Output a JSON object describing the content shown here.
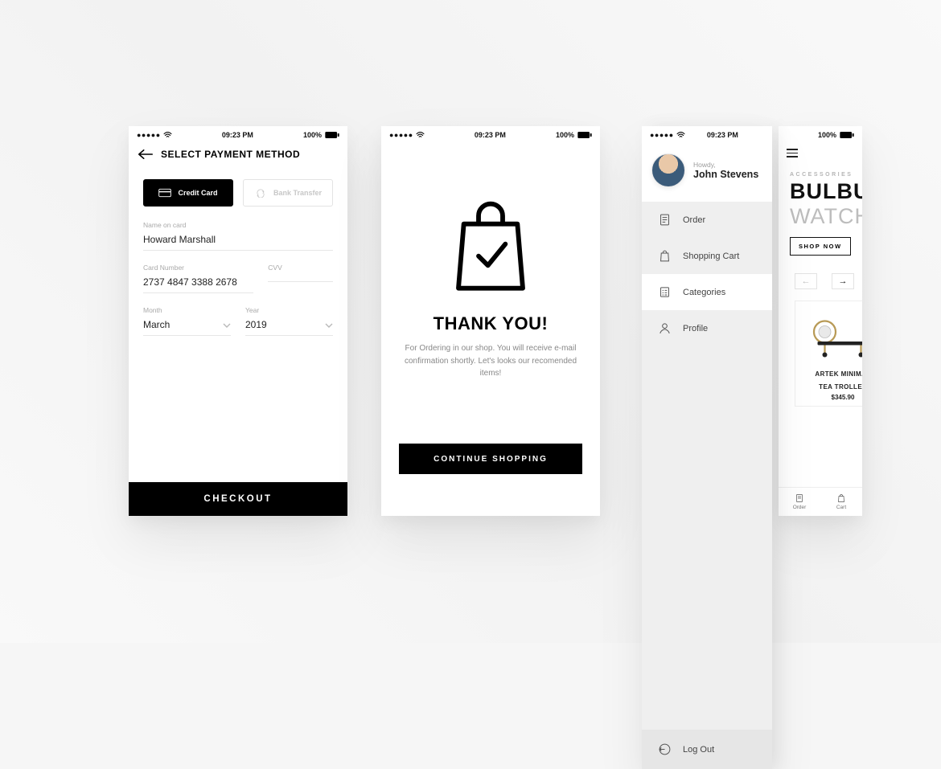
{
  "status": {
    "time": "09:23 PM",
    "battery": "100%"
  },
  "screen1": {
    "title": "SELECT PAYMENT METHOD",
    "tabs": {
      "credit": "Credit Card",
      "bank": "Bank Transfer"
    },
    "labels": {
      "name": "Name on card",
      "cardnum": "Card Number",
      "cvv": "CVV",
      "month": "Month",
      "year": "Year"
    },
    "values": {
      "name": "Howard Marshall",
      "cardnum": "2737 4847 3388 2678",
      "cvv": "",
      "month": "March",
      "year": "2019"
    },
    "checkout": "CHECKOUT"
  },
  "screen2": {
    "heading": "THANK YOU!",
    "body": "For Ordering in our shop. You will receive e-mail confirmation shortly. Let's looks our recomended items!",
    "cta": "CONTINUE SHOPPING"
  },
  "screen3": {
    "greeting": "Howdy,",
    "username": "John Stevens",
    "nav": {
      "order": "Order",
      "cart": "Shopping Cart",
      "categories": "Categories",
      "profile": "Profile"
    },
    "logout": "Log Out"
  },
  "screen4": {
    "kicker": "ACCESSORIES",
    "headline1": "BULBUL",
    "headline2": "WATCH",
    "shop": "SHOP NOW",
    "product": {
      "name1": "ARTEK MINIMAL",
      "name2": "TEA TROLLEY",
      "price": "$345.90"
    },
    "tabbar": {
      "order": "Order",
      "cart": "Cart"
    }
  }
}
